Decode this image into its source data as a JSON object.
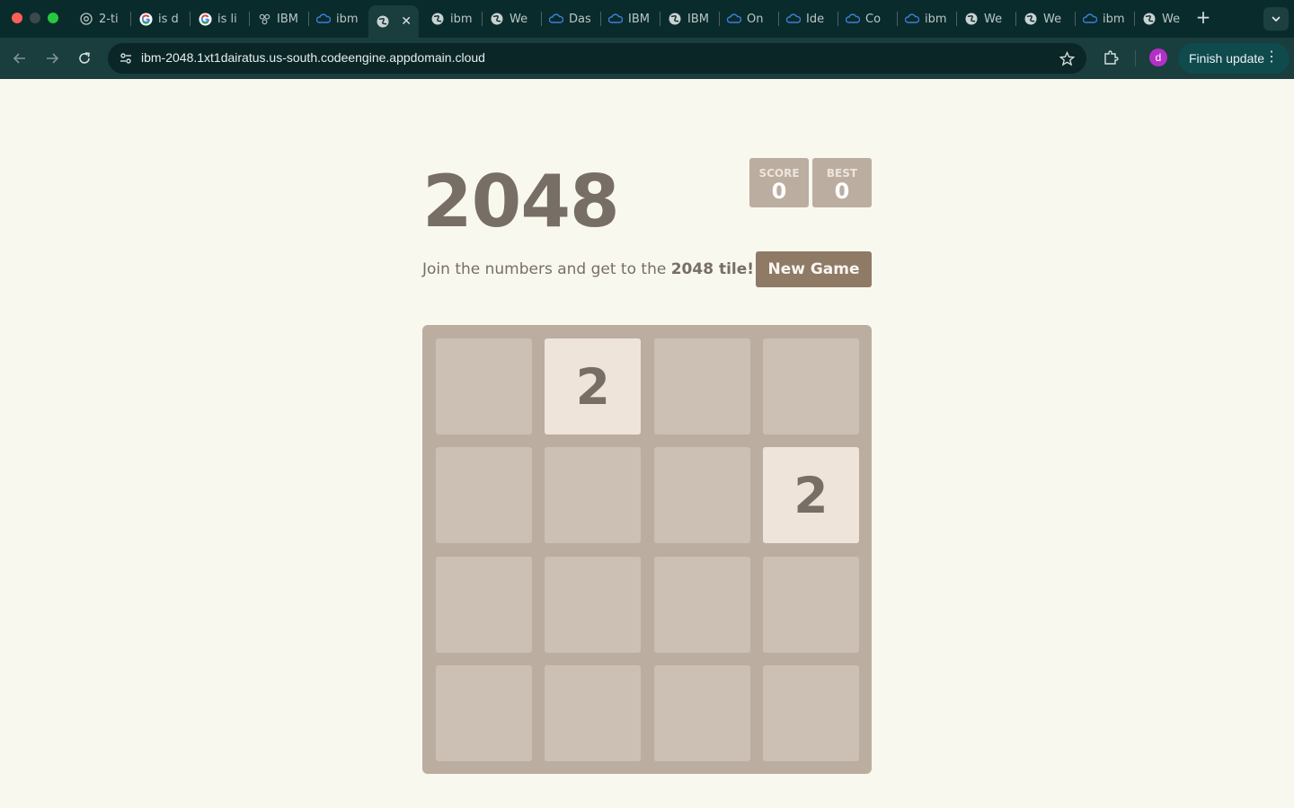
{
  "browser": {
    "tabs": [
      {
        "title": "2-ti",
        "icon": "chromium-icon"
      },
      {
        "title": "is d",
        "icon": "google-icon"
      },
      {
        "title": "is li",
        "icon": "google-icon"
      },
      {
        "title": "IBM",
        "icon": "ibm-granite-icon"
      },
      {
        "title": "ibm",
        "icon": "ibm-cloud-icon"
      },
      {
        "title": "",
        "icon": "globe-icon",
        "active": true
      },
      {
        "title": "ibm",
        "icon": "globe-icon"
      },
      {
        "title": "We",
        "icon": "globe-icon"
      },
      {
        "title": "Das",
        "icon": "ibm-cloud-icon"
      },
      {
        "title": "IBM",
        "icon": "ibm-cloud-icon"
      },
      {
        "title": "IBM",
        "icon": "globe-icon"
      },
      {
        "title": "On",
        "icon": "ibm-cloud-icon"
      },
      {
        "title": "Ide",
        "icon": "ibm-cloud-icon"
      },
      {
        "title": "Co",
        "icon": "ibm-cloud-icon"
      },
      {
        "title": "ibm",
        "icon": "ibm-cloud-icon"
      },
      {
        "title": "We",
        "icon": "globe-icon"
      },
      {
        "title": "We",
        "icon": "globe-icon"
      },
      {
        "title": "ibm",
        "icon": "ibm-cloud-icon"
      },
      {
        "title": "We",
        "icon": "globe-icon"
      }
    ],
    "url": "ibm-2048.1xt1dairatus.us-south.codeengine.appdomain.cloud",
    "profile_initial": "d",
    "finish_update_label": "Finish update"
  },
  "game": {
    "title": "2048",
    "score_label": "SCORE",
    "score_value": "0",
    "best_label": "BEST",
    "best_value": "0",
    "intro_prefix": "Join the numbers and get to the",
    "intro_bold": "2048 tile!",
    "new_game_label": "New Game",
    "grid": [
      [
        0,
        2,
        0,
        0
      ],
      [
        0,
        0,
        0,
        2
      ],
      [
        0,
        0,
        0,
        0
      ],
      [
        0,
        0,
        0,
        0
      ]
    ]
  },
  "colors": {
    "page_background": "#f9f8ef",
    "board": "#bbada0",
    "tile_2": "#eee4da",
    "text": "#776e65",
    "button": "#8f7a66",
    "chrome_dark": "#0a2b2c"
  }
}
